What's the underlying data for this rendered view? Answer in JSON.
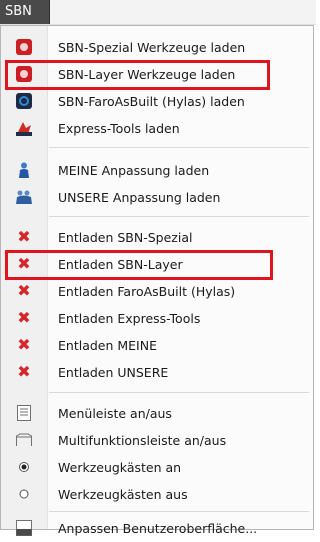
{
  "menu": {
    "title": "SBN",
    "groups": [
      {
        "items": [
          {
            "label": "SBN-Spezial Werkzeuge laden",
            "icon": "sbn-spezial-icon"
          },
          {
            "label": "SBN-Layer Werkzeuge laden",
            "icon": "sbn-layer-icon"
          },
          {
            "label": "SBN-FaroAsBuilt (Hylas) laden",
            "icon": "faro-asbuilt-icon"
          },
          {
            "label": "Express-Tools laden",
            "icon": "express-tools-icon"
          }
        ]
      },
      {
        "items": [
          {
            "label": "MEINE Anpassung laden",
            "icon": "single-user-icon"
          },
          {
            "label": "UNSERE Anpassung laden",
            "icon": "user-group-icon"
          }
        ]
      },
      {
        "items": [
          {
            "label": "Entladen SBN-Spezial",
            "icon": "red-x-icon"
          },
          {
            "label": "Entladen SBN-Layer",
            "icon": "red-x-icon"
          },
          {
            "label": "Entladen FaroAsBuilt (Hylas)",
            "icon": "red-x-icon"
          },
          {
            "label": "Entladen Express-Tools",
            "icon": "red-x-icon"
          },
          {
            "label": "Entladen MEINE",
            "icon": "red-x-icon"
          },
          {
            "label": "Entladen UNSERE",
            "icon": "red-x-icon"
          }
        ]
      },
      {
        "items": [
          {
            "label": "Menüleiste an/aus",
            "icon": "menubar-icon"
          },
          {
            "label": "Multifunktionsleiste an/aus",
            "icon": "ribbon-icon"
          },
          {
            "label": "Werkzeugkästen an",
            "icon": "radio-selected-icon"
          },
          {
            "label": "Werkzeugkästen aus",
            "icon": "radio-empty-icon"
          }
        ]
      },
      {
        "items": [
          {
            "label": "Anpassen Benutzeroberfläche...",
            "icon": "cui-icon"
          }
        ]
      }
    ]
  },
  "colors": {
    "highlight": "#e0141e",
    "menu_title_bg": "#4a4a4a",
    "red_x": "#d6252b"
  }
}
